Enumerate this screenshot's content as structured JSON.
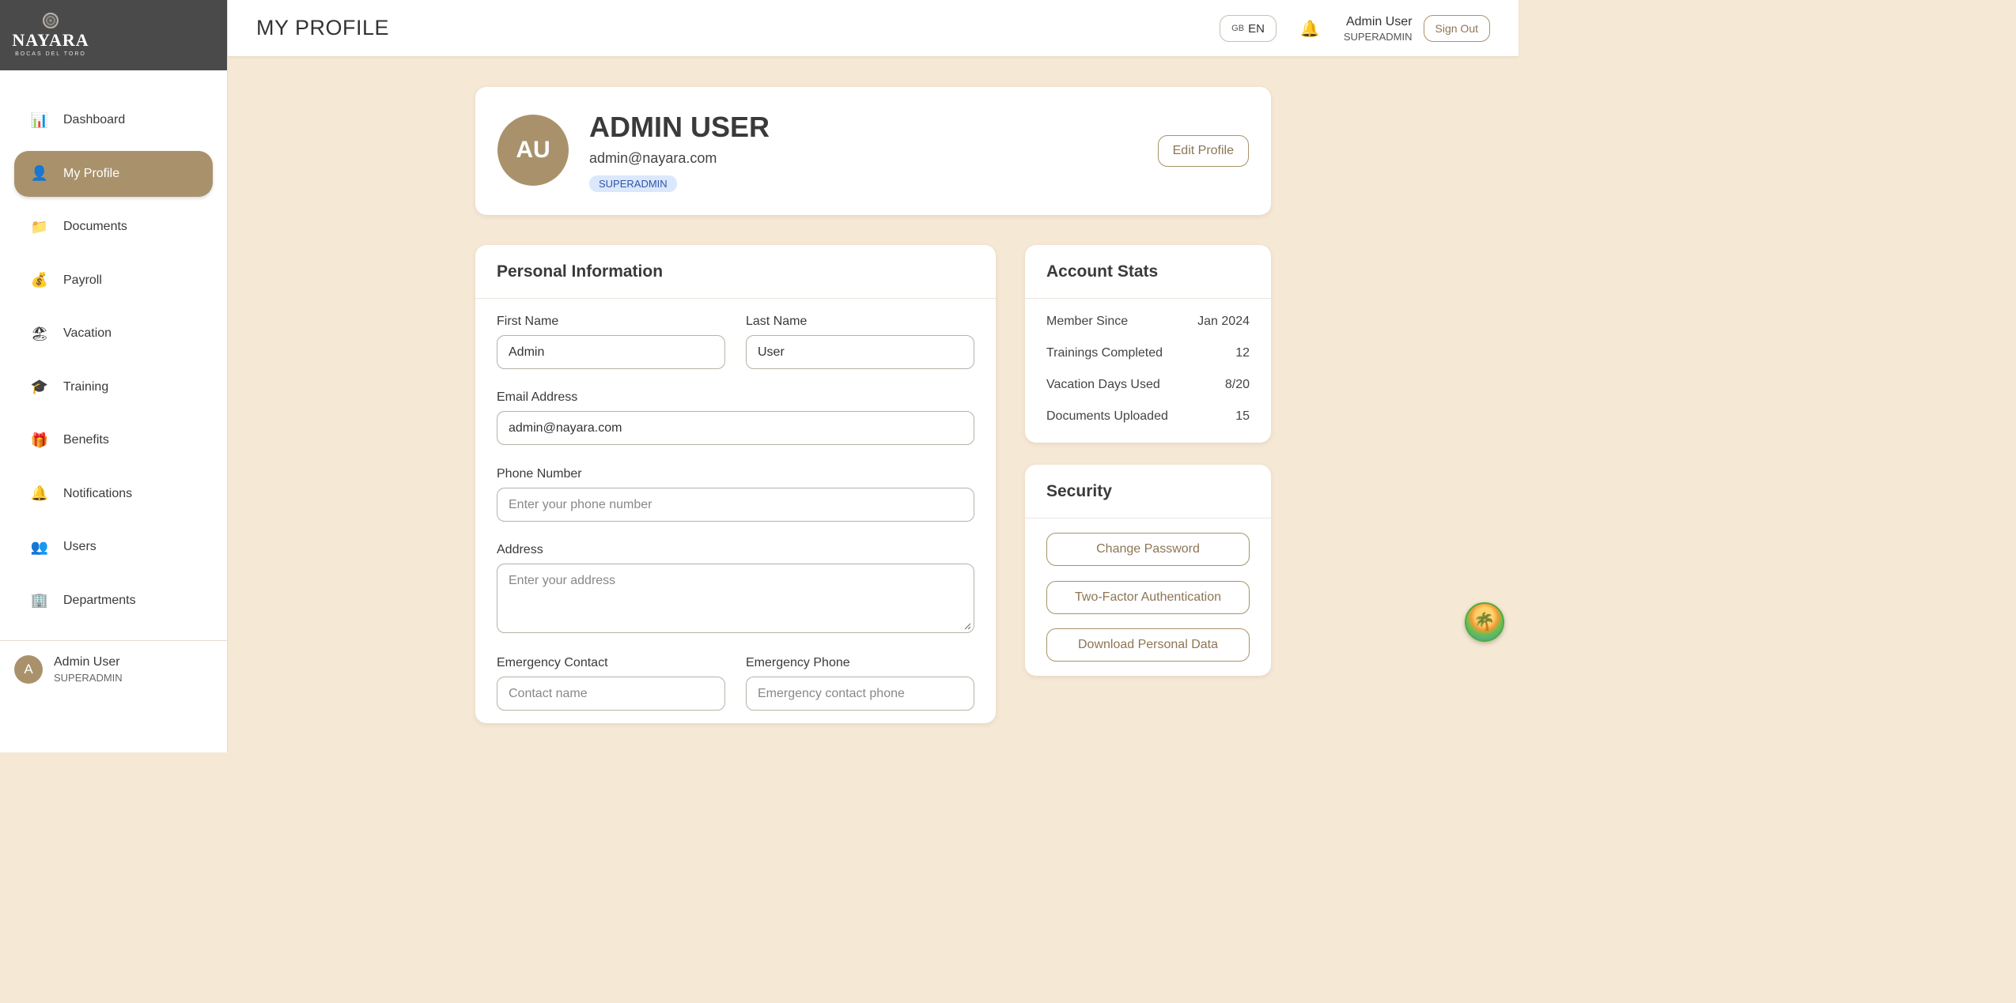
{
  "brand": {
    "name": "NAYARA",
    "subtitle": "BOCAS DEL TORO"
  },
  "sidebar": {
    "items": [
      {
        "label": "Dashboard",
        "icon": "bar-chart-icon",
        "glyph": "📊"
      },
      {
        "label": "My Profile",
        "icon": "user-icon",
        "glyph": "👤",
        "active": true
      },
      {
        "label": "Documents",
        "icon": "folder-icon",
        "glyph": "📁"
      },
      {
        "label": "Payroll",
        "icon": "money-bag-icon",
        "glyph": "💰"
      },
      {
        "label": "Vacation",
        "icon": "beach-icon",
        "glyph": "🏖"
      },
      {
        "label": "Training",
        "icon": "graduation-cap-icon",
        "glyph": "🎓"
      },
      {
        "label": "Benefits",
        "icon": "gift-icon",
        "glyph": "🎁"
      },
      {
        "label": "Notifications",
        "icon": "bell-icon",
        "glyph": "🔔"
      },
      {
        "label": "Users",
        "icon": "users-icon",
        "glyph": "👥"
      },
      {
        "label": "Departments",
        "icon": "building-icon",
        "glyph": "🏢"
      }
    ],
    "user": {
      "initial": "A",
      "name": "Admin User",
      "role": "SUPERADMIN"
    }
  },
  "header": {
    "title": "MY PROFILE",
    "lang_flag": "GB",
    "lang": "EN",
    "user_name": "Admin User",
    "user_role": "SUPERADMIN",
    "signout_label": "Sign Out"
  },
  "profile": {
    "initials": "AU",
    "name": "ADMIN USER",
    "email": "admin@nayara.com",
    "role_badge": "SUPERADMIN",
    "edit_label": "Edit Profile"
  },
  "personal_info": {
    "title": "Personal Information",
    "first_name_label": "First Name",
    "first_name_value": "Admin",
    "last_name_label": "Last Name",
    "last_name_value": "User",
    "email_label": "Email Address",
    "email_value": "admin@nayara.com",
    "phone_label": "Phone Number",
    "phone_placeholder": "Enter your phone number",
    "address_label": "Address",
    "address_placeholder": "Enter your address",
    "emergency_contact_label": "Emergency Contact",
    "emergency_contact_placeholder": "Contact name",
    "emergency_phone_label": "Emergency Phone",
    "emergency_phone_placeholder": "Emergency contact phone"
  },
  "account_stats": {
    "title": "Account Stats",
    "rows": [
      {
        "label": "Member Since",
        "value": "Jan 2024"
      },
      {
        "label": "Trainings Completed",
        "value": "12"
      },
      {
        "label": "Vacation Days Used",
        "value": "8/20"
      },
      {
        "label": "Documents Uploaded",
        "value": "15"
      }
    ]
  },
  "security": {
    "title": "Security",
    "change_password": "Change Password",
    "two_factor": "Two-Factor Authentication",
    "download_data": "Download Personal Data"
  },
  "colors": {
    "accent": "#a9926b",
    "background": "#f5e8d4",
    "badge_bg": "#dbe7fb",
    "badge_text": "#2f56a8"
  }
}
